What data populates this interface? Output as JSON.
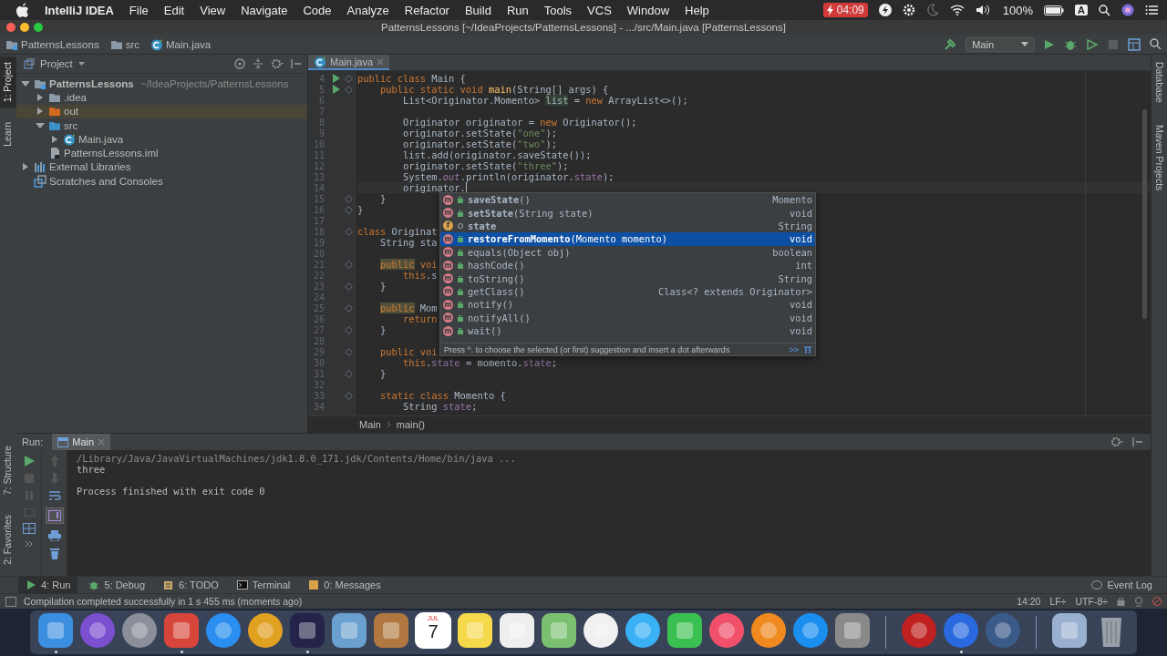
{
  "menubar": {
    "app": "IntelliJ IDEA",
    "menus": [
      "File",
      "Edit",
      "View",
      "Navigate",
      "Code",
      "Analyze",
      "Refactor",
      "Build",
      "Run",
      "Tools",
      "VCS",
      "Window",
      "Help"
    ],
    "battery_alert": "04:09",
    "battery": "100%",
    "input_source": "A"
  },
  "window": {
    "title": "PatternsLessons [~/IdeaProjects/PatternsLessons] - .../src/Main.java [PatternsLessons]"
  },
  "navigation": [
    {
      "label": "PatternsLessons",
      "kind": "module"
    },
    {
      "label": "src",
      "kind": "folder"
    },
    {
      "label": "Main.java",
      "kind": "class"
    }
  ],
  "run_config": {
    "label": "Main"
  },
  "left_tools": {
    "top": [
      {
        "label": "1: Project",
        "selected": true
      },
      {
        "label": "Learn",
        "selected": false
      }
    ],
    "bottom": [
      {
        "label": "7: Structure",
        "selected": false
      },
      {
        "label": "2: Favorites",
        "selected": false
      }
    ]
  },
  "right_tools": [
    {
      "label": "Database"
    },
    {
      "label": "Maven Projects"
    }
  ],
  "project": {
    "title": "Project",
    "tree": [
      {
        "label": "PatternsLessons",
        "hint": "~/IdeaProjects/PatternsLessons",
        "kind": "module",
        "expanded": true,
        "selected": false,
        "children": [
          {
            "label": ".idea",
            "kind": "folder",
            "expanded": false,
            "selected": false
          },
          {
            "label": "out",
            "kind": "excluded",
            "expanded": false,
            "selected": true
          },
          {
            "label": "src",
            "kind": "source",
            "expanded": true,
            "selected": false,
            "children": [
              {
                "label": "Main.java",
                "kind": "class",
                "expanded": false,
                "selected": false
              }
            ]
          },
          {
            "label": "PatternsLessons.iml",
            "kind": "file",
            "selected": false
          }
        ]
      },
      {
        "label": "External Libraries",
        "kind": "libraries",
        "expanded": false,
        "selected": false
      },
      {
        "label": "Scratches and Consoles",
        "kind": "scratches",
        "selected": false
      }
    ]
  },
  "editor": {
    "tabs": [
      {
        "label": "Main.java",
        "selected": true
      }
    ],
    "lines": [
      {
        "number": "4",
        "run": true,
        "fold": true,
        "tokens": [
          {
            "kind": "keyword",
            "text": "public class "
          },
          {
            "kind": "plain",
            "text": "Main {"
          }
        ]
      },
      {
        "number": "5",
        "run": true,
        "fold": true,
        "tokens": [
          {
            "kind": "keyword",
            "text": "    public static void "
          },
          {
            "kind": "method",
            "text": "main"
          },
          {
            "kind": "plain",
            "text": "(String[] args) {"
          }
        ]
      },
      {
        "number": "6",
        "run": false,
        "fold": false,
        "tokens": [
          {
            "kind": "plain",
            "text": "        List<Originator.Momento> "
          },
          {
            "kind": "usage",
            "text": "list"
          },
          {
            "kind": "plain",
            "text": " = "
          },
          {
            "kind": "keyword",
            "text": "new "
          },
          {
            "kind": "plain",
            "text": "ArrayList<>();"
          }
        ]
      },
      {
        "number": "7",
        "run": false,
        "fold": false
      },
      {
        "number": "8",
        "run": false,
        "fold": false,
        "tokens": [
          {
            "kind": "plain",
            "text": "        Originator originator = "
          },
          {
            "kind": "keyword",
            "text": "new "
          },
          {
            "kind": "plain",
            "text": "Originator();"
          }
        ]
      },
      {
        "number": "9",
        "run": false,
        "fold": false,
        "tokens": [
          {
            "kind": "plain",
            "text": "        originator.setState("
          },
          {
            "kind": "string",
            "text": "\"one\""
          },
          {
            "kind": "plain",
            "text": ");"
          }
        ]
      },
      {
        "number": "10",
        "run": false,
        "fold": false,
        "tokens": [
          {
            "kind": "plain",
            "text": "        originator.setState("
          },
          {
            "kind": "string",
            "text": "\"two\""
          },
          {
            "kind": "plain",
            "text": ");"
          }
        ]
      },
      {
        "number": "11",
        "run": false,
        "fold": false,
        "tokens": [
          {
            "kind": "plain",
            "text": "        list.add(originator.saveState());"
          }
        ]
      },
      {
        "number": "12",
        "run": false,
        "fold": false,
        "tokens": [
          {
            "kind": "plain",
            "text": "        originator.setState("
          },
          {
            "kind": "string",
            "text": "\"three\""
          },
          {
            "kind": "plain",
            "text": ");"
          }
        ]
      },
      {
        "number": "13",
        "run": false,
        "fold": false,
        "tokens": [
          {
            "kind": "plain",
            "text": "        System."
          },
          {
            "kind": "static",
            "text": "out"
          },
          {
            "kind": "plain",
            "text": ".println(originator."
          },
          {
            "kind": "field",
            "text": "state"
          },
          {
            "kind": "plain",
            "text": ");"
          }
        ]
      },
      {
        "number": "14",
        "run": false,
        "fold": false,
        "tokens": [
          {
            "kind": "plain",
            "text": "        originator."
          },
          {
            "kind": "caret"
          }
        ]
      },
      {
        "number": "15",
        "run": false,
        "fold": true,
        "tokens": [
          {
            "kind": "plain",
            "text": "    }"
          }
        ]
      },
      {
        "number": "16",
        "run": false,
        "fold": true,
        "tokens": [
          {
            "kind": "plain",
            "text": "}"
          }
        ]
      },
      {
        "number": "17",
        "run": false,
        "fold": false
      },
      {
        "number": "18",
        "run": false,
        "fold": true,
        "tokens": [
          {
            "kind": "keyword",
            "text": "class "
          },
          {
            "kind": "plain",
            "text": "Originat"
          }
        ]
      },
      {
        "number": "19",
        "run": false,
        "fold": false,
        "tokens": [
          {
            "kind": "plain",
            "text": "    String sta"
          }
        ]
      },
      {
        "number": "20",
        "run": false,
        "fold": false
      },
      {
        "number": "21",
        "run": false,
        "fold": true,
        "tokens": [
          {
            "kind": "warning",
            "text": "    public"
          },
          {
            "kind": "keyword",
            "text": " voi"
          }
        ]
      },
      {
        "number": "22",
        "run": false,
        "fold": false,
        "tokens": [
          {
            "kind": "keyword",
            "text": "        this"
          },
          {
            "kind": "plain",
            "text": ".s"
          }
        ]
      },
      {
        "number": "23",
        "run": false,
        "fold": true,
        "tokens": [
          {
            "kind": "plain",
            "text": "    }"
          }
        ]
      },
      {
        "number": "24",
        "run": false,
        "fold": false
      },
      {
        "number": "25",
        "run": false,
        "fold": true,
        "tokens": [
          {
            "kind": "warning",
            "text": "    public"
          },
          {
            "kind": "plain",
            "text": " Mom"
          }
        ]
      },
      {
        "number": "26",
        "run": false,
        "fold": false,
        "tokens": [
          {
            "kind": "keyword",
            "text": "        return"
          }
        ]
      },
      {
        "number": "27",
        "run": false,
        "fold": true,
        "tokens": [
          {
            "kind": "plain",
            "text": "    }"
          }
        ]
      },
      {
        "number": "28",
        "run": false,
        "fold": false
      },
      {
        "number": "29",
        "run": false,
        "fold": true,
        "tokens": [
          {
            "kind": "keyword",
            "text": "    public voi"
          }
        ]
      },
      {
        "number": "30",
        "run": false,
        "fold": false,
        "tokens": [
          {
            "kind": "keyword",
            "text": "        this"
          },
          {
            "kind": "plain",
            "text": "."
          },
          {
            "kind": "field",
            "text": "state"
          },
          {
            "kind": "plain",
            "text": " = momento."
          },
          {
            "kind": "field",
            "text": "state"
          },
          {
            "kind": "plain",
            "text": ";"
          }
        ]
      },
      {
        "number": "31",
        "run": false,
        "fold": true,
        "tokens": [
          {
            "kind": "plain",
            "text": "    }"
          }
        ]
      },
      {
        "number": "32",
        "run": false,
        "fold": false
      },
      {
        "number": "33",
        "run": false,
        "fold": true,
        "tokens": [
          {
            "kind": "keyword",
            "text": "    static class "
          },
          {
            "kind": "plain",
            "text": "Momento {"
          }
        ]
      },
      {
        "number": "34",
        "run": false,
        "fold": false,
        "tokens": [
          {
            "kind": "plain",
            "text": "        String "
          },
          {
            "kind": "field",
            "text": "state"
          },
          {
            "kind": "plain",
            "text": ";"
          }
        ]
      }
    ],
    "completion": {
      "items": [
        {
          "kind": "method",
          "badge": "m",
          "name": "saveState",
          "params": "()",
          "type": "Momento",
          "bold": true,
          "selected": false
        },
        {
          "kind": "method",
          "badge": "m",
          "name": "setState",
          "params": "(String state)",
          "type": "void",
          "bold": true,
          "selected": false
        },
        {
          "kind": "field",
          "badge": "f",
          "name": "state",
          "type": "String",
          "bold": true,
          "selected": false
        },
        {
          "kind": "method",
          "badge": "m",
          "name": "restoreFromMomento",
          "params": "(Momento momento)",
          "type": "void",
          "bold": true,
          "selected": true
        },
        {
          "kind": "method",
          "badge": "m",
          "name": "equals",
          "params": "(Object obj)",
          "type": "boolean",
          "bold": false,
          "selected": false
        },
        {
          "kind": "method",
          "badge": "m",
          "name": "hashCode",
          "params": "()",
          "type": "int",
          "bold": false,
          "selected": false
        },
        {
          "kind": "method",
          "badge": "m",
          "name": "toString",
          "params": "()",
          "type": "String",
          "bold": false,
          "selected": false
        },
        {
          "kind": "method",
          "badge": "m",
          "name": "getClass",
          "params": "()",
          "type": "Class<? extends Originator>",
          "bold": false,
          "selected": false
        },
        {
          "kind": "method",
          "badge": "m",
          "name": "notify",
          "params": "()",
          "type": "void",
          "bold": false,
          "selected": false
        },
        {
          "kind": "method",
          "badge": "m",
          "name": "notifyAll",
          "params": "()",
          "type": "void",
          "bold": false,
          "selected": false
        },
        {
          "kind": "method",
          "badge": "m",
          "name": "wait",
          "params": "()",
          "type": "void",
          "bold": false,
          "selected": false
        }
      ],
      "hint": "Press ^. to choose the selected (or first) suggestion and insert a dot afterwards",
      "hint_link": ">>"
    },
    "breadcrumb": [
      "Main",
      "main()"
    ]
  },
  "run": {
    "title": "Run:",
    "tabs": [
      {
        "label": "Main",
        "selected": true
      }
    ],
    "output": [
      {
        "kind": "command",
        "text": "/Library/Java/JavaVirtualMachines/jdk1.8.0_171.jdk/Contents/Home/bin/java ..."
      },
      {
        "kind": "stdout",
        "text": "three"
      },
      {
        "kind": "exit",
        "text": "Process finished with exit code 0"
      }
    ]
  },
  "tool_tabs": [
    {
      "label": "4: Run",
      "kind": "run",
      "selected": true
    },
    {
      "label": "5: Debug",
      "kind": "debug",
      "selected": false
    },
    {
      "label": "6: TODO",
      "kind": "todo",
      "selected": false
    },
    {
      "label": "Terminal",
      "kind": "terminal",
      "selected": false
    },
    {
      "label": "0: Messages",
      "kind": "messages",
      "selected": false
    }
  ],
  "event_log": "Event Log",
  "status": {
    "message": "Compilation completed successfully in 1 s 455 ms (moments ago)",
    "position": "14:20",
    "line_separator": "LF÷",
    "encoding": "UTF-8÷"
  },
  "dock": [
    {
      "kind": "square",
      "color": "#3a8fe0",
      "running": true
    },
    {
      "kind": "circle",
      "color": "#7a4fd0",
      "running": false
    },
    {
      "kind": "circle",
      "color": "#8a8f99",
      "running": false
    },
    {
      "kind": "square",
      "color": "#d8453a",
      "running": true
    },
    {
      "kind": "circle",
      "color": "#2a8ff0",
      "running": false
    },
    {
      "kind": "circle",
      "color": "#e0a020",
      "running": false
    },
    {
      "kind": "square",
      "color": "#24244a",
      "running": true
    },
    {
      "kind": "square",
      "color": "#6aa0d0",
      "running": false
    },
    {
      "kind": "square",
      "color": "#b07840",
      "running": false
    },
    {
      "kind": "calendar",
      "month": "JUL",
      "day": "7",
      "running": false
    },
    {
      "kind": "square",
      "color": "#f5d94a",
      "running": false
    },
    {
      "kind": "square",
      "color": "#eeeeee",
      "running": false
    },
    {
      "kind": "square",
      "color": "#7ac070",
      "running": false
    },
    {
      "kind": "circle",
      "color": "#f0f0f0",
      "running": false
    },
    {
      "kind": "circle",
      "color": "#3ab0f5",
      "running": false
    },
    {
      "kind": "square",
      "color": "#3ac050",
      "running": false
    },
    {
      "kind": "circle",
      "color": "#f0506a",
      "running": false
    },
    {
      "kind": "circle",
      "color": "#f08a20",
      "running": false
    },
    {
      "kind": "circle",
      "color": "#1a8ff0",
      "running": false
    },
    {
      "kind": "square",
      "color": "#8a8a8a",
      "running": false
    },
    {
      "kind": "separator"
    },
    {
      "kind": "circle",
      "color": "#c02020",
      "running": false
    },
    {
      "kind": "circle",
      "color": "#2a6ae0",
      "running": true
    },
    {
      "kind": "circle",
      "color": "#3a5a8a",
      "running": false
    },
    {
      "kind": "separator"
    },
    {
      "kind": "square",
      "color": "#9ab0d0",
      "running": false
    },
    {
      "kind": "trash",
      "running": false
    }
  ]
}
